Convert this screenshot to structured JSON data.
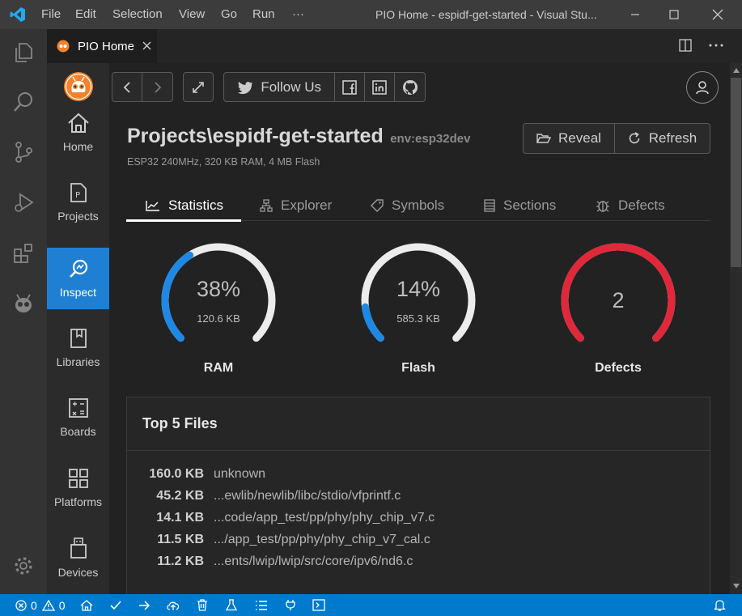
{
  "titlebar": {
    "menu": [
      "File",
      "Edit",
      "Selection",
      "View",
      "Go",
      "Run",
      "···"
    ],
    "title": "PIO Home - espidf-get-started - Visual Stu..."
  },
  "editor_tab": {
    "label": "PIO Home"
  },
  "nav": {
    "items": [
      {
        "label": "Home",
        "icon": "home-icon"
      },
      {
        "label": "Projects",
        "icon": "projects-icon"
      },
      {
        "label": "Inspect",
        "icon": "inspect-icon",
        "active": true
      },
      {
        "label": "Libraries",
        "icon": "libraries-icon"
      },
      {
        "label": "Boards",
        "icon": "boards-icon"
      },
      {
        "label": "Platforms",
        "icon": "platforms-icon"
      },
      {
        "label": "Devices",
        "icon": "devices-icon"
      }
    ]
  },
  "toolbar": {
    "follow_label": "Follow Us"
  },
  "project": {
    "title": "Projects\\espidf-get-started",
    "env": "env:esp32dev",
    "subtitle": "ESP32 240MHz, 320 KB RAM, 4 MB Flash",
    "reveal_label": "Reveal",
    "refresh_label": "Refresh"
  },
  "tabs": [
    "Statistics",
    "Explorer",
    "Symbols",
    "Sections",
    "Defects"
  ],
  "gauges": [
    {
      "name": "RAM",
      "value": "38%",
      "sub": "120.6 KB",
      "fraction": 0.38,
      "color": "#1e88e5"
    },
    {
      "name": "Flash",
      "value": "14%",
      "sub": "585.3 KB",
      "fraction": 0.14,
      "color": "#1e88e5"
    },
    {
      "name": "Defects",
      "value": "2",
      "sub": "",
      "fraction": 1.0,
      "color": "#e0283a"
    }
  ],
  "top_files": {
    "title": "Top 5 Files",
    "rows": [
      {
        "size": "160.0 KB",
        "name": "unknown"
      },
      {
        "size": "45.2 KB",
        "name": "...ewlib/newlib/libc/stdio/vfprintf.c"
      },
      {
        "size": "14.1 KB",
        "name": "...code/app_test/pp/phy/phy_chip_v7.c"
      },
      {
        "size": "11.5 KB",
        "name": ".../app_test/pp/phy/phy_chip_v7_cal.c"
      },
      {
        "size": "11.2 KB",
        "name": "...ents/lwip/lwip/src/core/ipv6/nd6.c"
      }
    ]
  },
  "statusbar": {
    "errors": "0",
    "warnings": "0"
  },
  "colors": {
    "accent": "#007acc",
    "active_nav": "#1f7fd3",
    "pio_orange": "#f5822a"
  }
}
